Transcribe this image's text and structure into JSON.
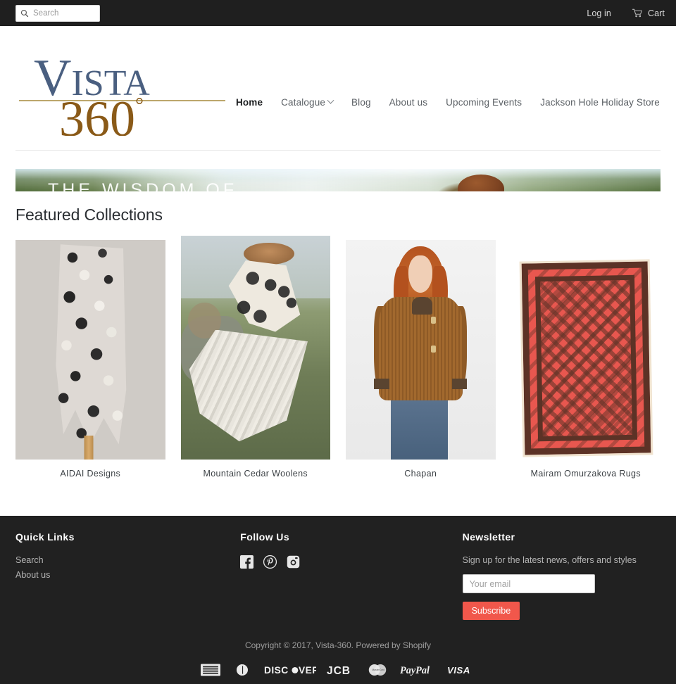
{
  "topbar": {
    "search": {
      "placeholder": "Search",
      "icon": "search-icon",
      "value": ""
    },
    "login_label": "Log in",
    "cart_label": "Cart",
    "cart_icon": "shopping-cart-icon",
    "background": "#1f1f1f"
  },
  "header": {
    "logo": {
      "line1": "VISTA",
      "line2": "360",
      "degree": "°",
      "navy": "#4a5f80",
      "gold": "#8a6b28"
    },
    "nav": [
      {
        "label": "Home",
        "active": true,
        "has_dropdown": false
      },
      {
        "label": "Catalogue",
        "active": false,
        "has_dropdown": true
      },
      {
        "label": "Blog",
        "active": false,
        "has_dropdown": false
      },
      {
        "label": "About us",
        "active": false,
        "has_dropdown": false
      },
      {
        "label": "Upcoming Events",
        "active": false,
        "has_dropdown": false
      },
      {
        "label": "Jackson Hole Holiday Store",
        "active": false,
        "has_dropdown": false
      }
    ]
  },
  "hero": {
    "caption": "THE WISDOM OF",
    "alt": "mountain landscape with person"
  },
  "featured": {
    "title": "Featured Collections",
    "items": [
      {
        "caption": "AIDAI Designs",
        "alt": "felted scarf with black and white circles"
      },
      {
        "caption": "Mountain Cedar Woolens",
        "alt": "wool shawl and blanket on hillside"
      },
      {
        "caption": "Chapan",
        "alt": "woman wearing brown quilted chapan jacket"
      },
      {
        "caption": "Mairam Omurzakova Rugs",
        "alt": "red and brown felt rug"
      }
    ]
  },
  "footer": {
    "background": "#212121",
    "quick_links": {
      "title": "Quick Links",
      "links": [
        "Search",
        "About us"
      ]
    },
    "follow": {
      "title": "Follow Us",
      "icons": [
        "facebook-icon",
        "pinterest-icon",
        "instagram-icon"
      ]
    },
    "newsletter": {
      "title": "Newsletter",
      "description": "Sign up for the latest news, offers and styles",
      "email_placeholder": "Your email",
      "email_value": "",
      "button_label": "Subscribe",
      "button_color": "#f1574b"
    },
    "copyright": "Copyright © 2017, Vista-360. Powered by Shopify",
    "payments": [
      "american-express",
      "diners-club",
      "discover",
      "jcb",
      "mastercard",
      "paypal",
      "visa"
    ],
    "payment_labels": {
      "discover": "DISCOVER",
      "jcb": "JCB",
      "paypal": "PayPal",
      "visa": "VISA"
    }
  }
}
